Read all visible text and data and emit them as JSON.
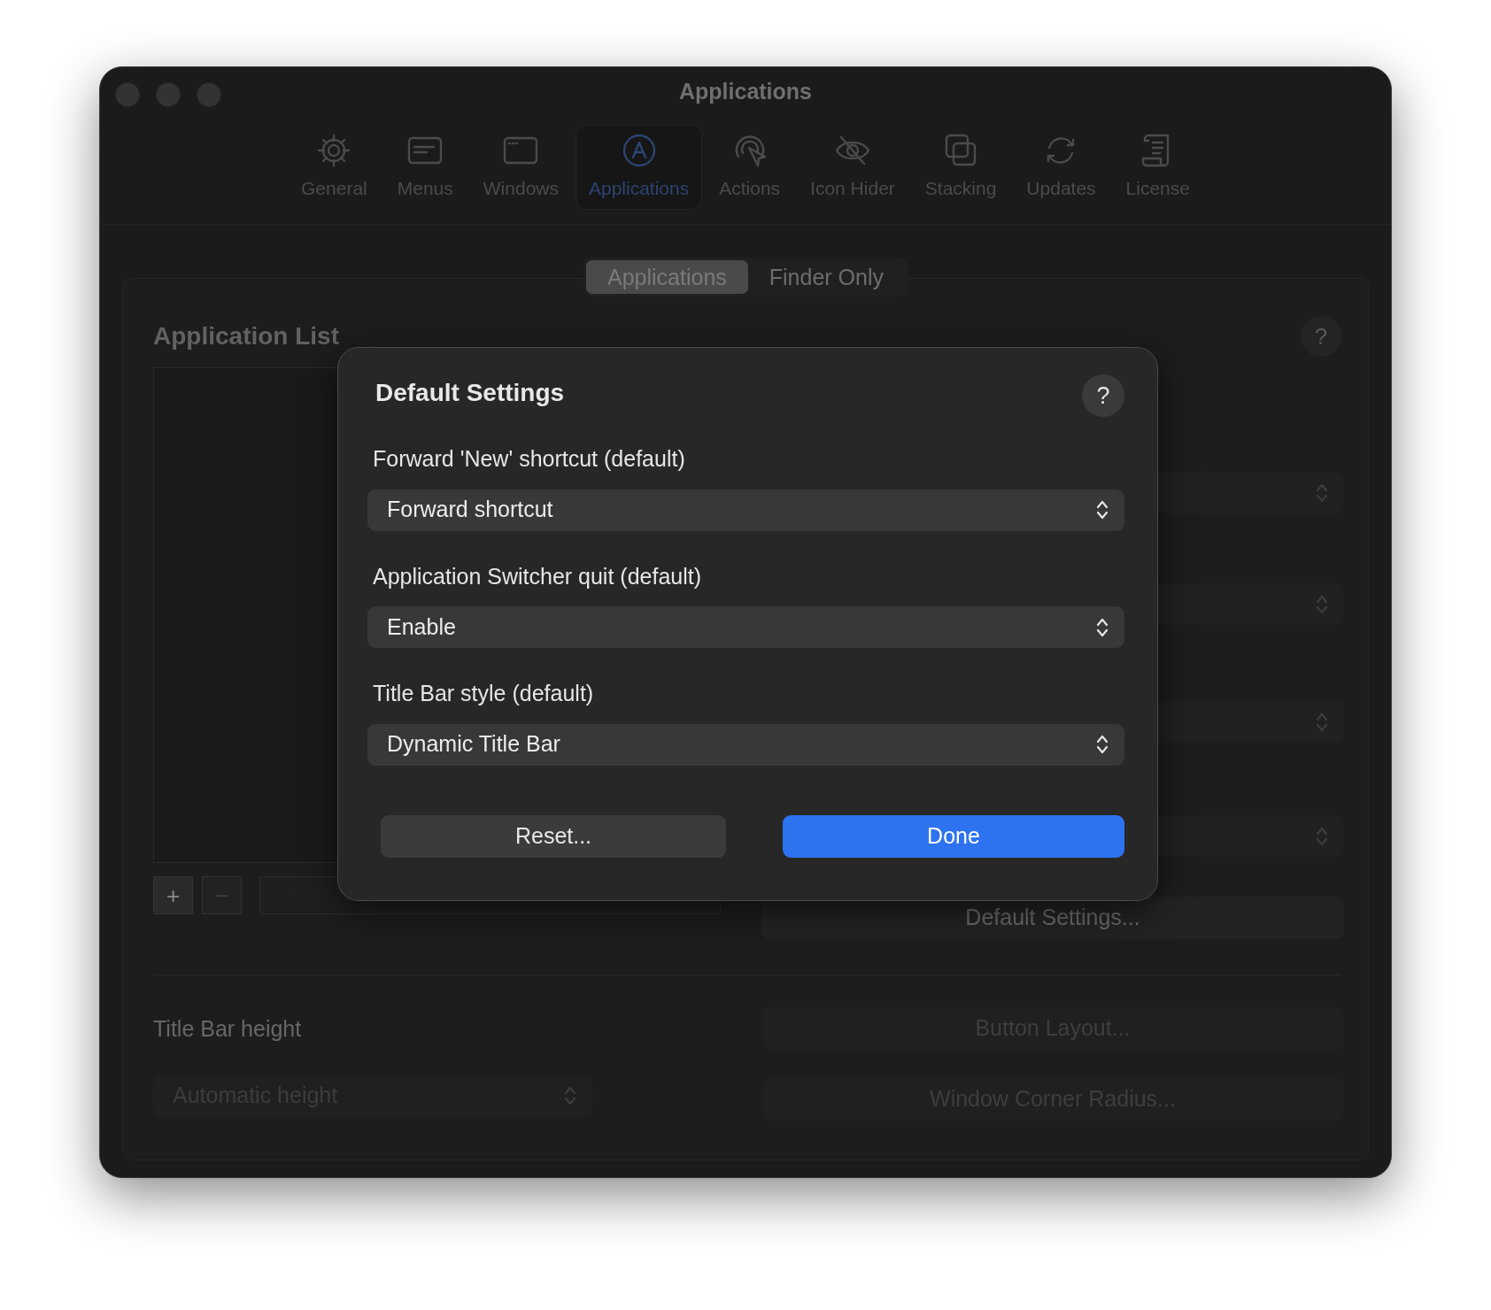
{
  "window": {
    "title": "Applications"
  },
  "toolbar": [
    {
      "label": "General",
      "kind": "gear",
      "selected": false
    },
    {
      "label": "Menus",
      "kind": "menubar",
      "selected": false
    },
    {
      "label": "Windows",
      "kind": "window",
      "selected": false
    },
    {
      "label": "Applications",
      "kind": "appletter",
      "selected": true
    },
    {
      "label": "Actions",
      "kind": "click",
      "selected": false
    },
    {
      "label": "Icon Hider",
      "kind": "eyeslash",
      "selected": false
    },
    {
      "label": "Stacking",
      "kind": "stack",
      "selected": false
    },
    {
      "label": "Updates",
      "kind": "sync",
      "selected": false
    },
    {
      "label": "License",
      "kind": "scroll",
      "selected": false
    }
  ],
  "segments": [
    {
      "label": "Applications",
      "selected": true
    },
    {
      "label": "Finder Only",
      "selected": false
    }
  ],
  "application_list": {
    "title": "Application List",
    "help": "?",
    "list_buttons": [
      {
        "label": "+",
        "disabled": false
      },
      {
        "label": "−",
        "disabled": true
      }
    ]
  },
  "default_settings_button": "Default Settings...",
  "title_bar_height": {
    "label": "Title Bar height",
    "value": "Automatic height",
    "disabled": true
  },
  "buttons": [
    {
      "label": "Button Layout...",
      "disabled": true
    },
    {
      "label": "Window Corner Radius...",
      "disabled": true
    }
  ],
  "sheet": {
    "title": "Default Settings",
    "help": "?",
    "fields": [
      {
        "label": "Forward 'New' shortcut (default)",
        "value": "Forward shortcut"
      },
      {
        "label": "Application Switcher quit (default)",
        "value": "Enable"
      },
      {
        "label": "Title Bar style (default)",
        "value": "Dynamic Title Bar"
      }
    ],
    "buttons": [
      {
        "label": "Reset...",
        "kind": "secondary"
      },
      {
        "label": "Done",
        "kind": "primary"
      }
    ]
  }
}
